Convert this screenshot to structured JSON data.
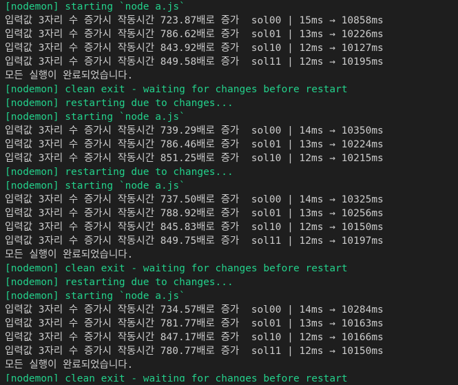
{
  "colors": {
    "background": "#1e1e1e",
    "text_default": "#cccccc",
    "text_nodemon": "#23d18b"
  },
  "terminal": {
    "lines": [
      {
        "kind": "green",
        "text": "[nodemon] starting `node a.js`"
      },
      {
        "kind": "white",
        "text": "입력값 3자리 수 증가시 작동시간 723.87배로 증가  sol00 | 15ms → 10858ms"
      },
      {
        "kind": "white",
        "text": "입력값 3자리 수 증가시 작동시간 786.62배로 증가  sol01 | 13ms → 10226ms"
      },
      {
        "kind": "white",
        "text": "입력값 3자리 수 증가시 작동시간 843.92배로 증가  sol10 | 12ms → 10127ms"
      },
      {
        "kind": "white",
        "text": "입력값 3자리 수 증가시 작동시간 849.58배로 증가  sol11 | 12ms → 10195ms"
      },
      {
        "kind": "white",
        "text": "모든 실행이 완료되었습니다."
      },
      {
        "kind": "green",
        "text": "[nodemon] clean exit - waiting for changes before restart"
      },
      {
        "kind": "green",
        "text": "[nodemon] restarting due to changes..."
      },
      {
        "kind": "green",
        "text": "[nodemon] starting `node a.js`"
      },
      {
        "kind": "white",
        "text": "입력값 3자리 수 증가시 작동시간 739.29배로 증가  sol00 | 14ms → 10350ms"
      },
      {
        "kind": "white",
        "text": "입력값 3자리 수 증가시 작동시간 786.46배로 증가  sol01 | 13ms → 10224ms"
      },
      {
        "kind": "white",
        "text": "입력값 3자리 수 증가시 작동시간 851.25배로 증가  sol10 | 12ms → 10215ms"
      },
      {
        "kind": "green",
        "text": "[nodemon] restarting due to changes..."
      },
      {
        "kind": "green",
        "text": "[nodemon] starting `node a.js`"
      },
      {
        "kind": "white",
        "text": "입력값 3자리 수 증가시 작동시간 737.50배로 증가  sol00 | 14ms → 10325ms"
      },
      {
        "kind": "white",
        "text": "입력값 3자리 수 증가시 작동시간 788.92배로 증가  sol01 | 13ms → 10256ms"
      },
      {
        "kind": "white",
        "text": "입력값 3자리 수 증가시 작동시간 845.83배로 증가  sol10 | 12ms → 10150ms"
      },
      {
        "kind": "white",
        "text": "입력값 3자리 수 증가시 작동시간 849.75배로 증가  sol11 | 12ms → 10197ms"
      },
      {
        "kind": "white",
        "text": "모든 실행이 완료되었습니다."
      },
      {
        "kind": "green",
        "text": "[nodemon] clean exit - waiting for changes before restart"
      },
      {
        "kind": "green",
        "text": "[nodemon] restarting due to changes..."
      },
      {
        "kind": "green",
        "text": "[nodemon] starting `node a.js`"
      },
      {
        "kind": "white",
        "text": "입력값 3자리 수 증가시 작동시간 734.57배로 증가  sol00 | 14ms → 10284ms"
      },
      {
        "kind": "white",
        "text": "입력값 3자리 수 증가시 작동시간 781.77배로 증가  sol01 | 13ms → 10163ms"
      },
      {
        "kind": "white",
        "text": "입력값 3자리 수 증가시 작동시간 847.17배로 증가  sol10 | 12ms → 10166ms"
      },
      {
        "kind": "white",
        "text": "입력값 3자리 수 증가시 작동시간 780.77배로 증가  sol11 | 12ms → 10150ms"
      },
      {
        "kind": "white",
        "text": "모든 실행이 완료되었습니다."
      },
      {
        "kind": "green",
        "text": "[nodemon] clean exit - waiting for changes before restart"
      }
    ]
  }
}
